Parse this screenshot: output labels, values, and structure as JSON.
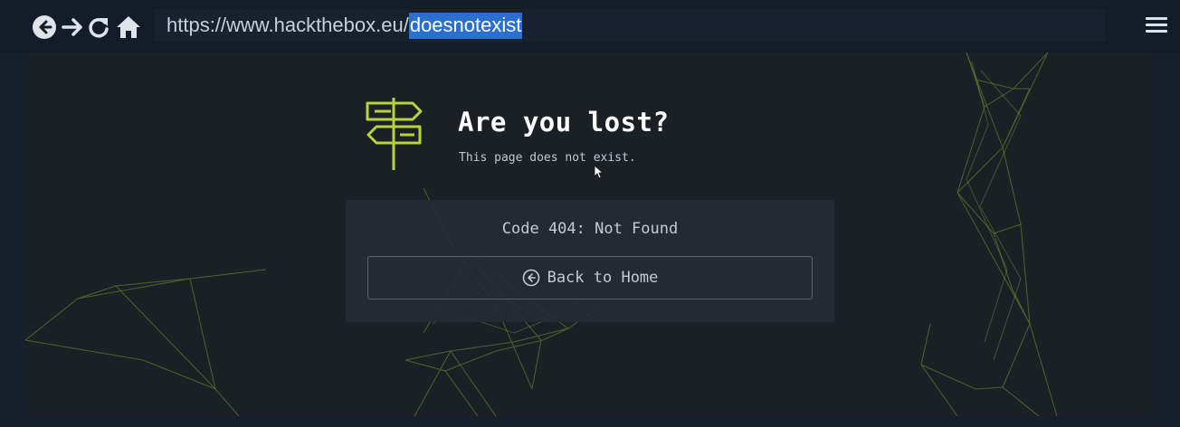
{
  "browser": {
    "url_base": "https://www.hackthebox.eu/",
    "url_selected": "doesnotexist",
    "icons": [
      "back-icon",
      "forward-icon",
      "reload-icon",
      "home-icon",
      "menu-icon"
    ]
  },
  "page": {
    "title": "Are you lost?",
    "subtitle": "This page does not exist.",
    "error_code": "Code 404: Not Found",
    "back_button_label": "Back to Home",
    "icons": [
      "signpost-icon",
      "back-arrow-circle-icon"
    ]
  },
  "colors": {
    "accent": "#9acd32",
    "background": "#1b1f26",
    "toolbar": "#141c29",
    "selection": "#2b6fd1"
  }
}
